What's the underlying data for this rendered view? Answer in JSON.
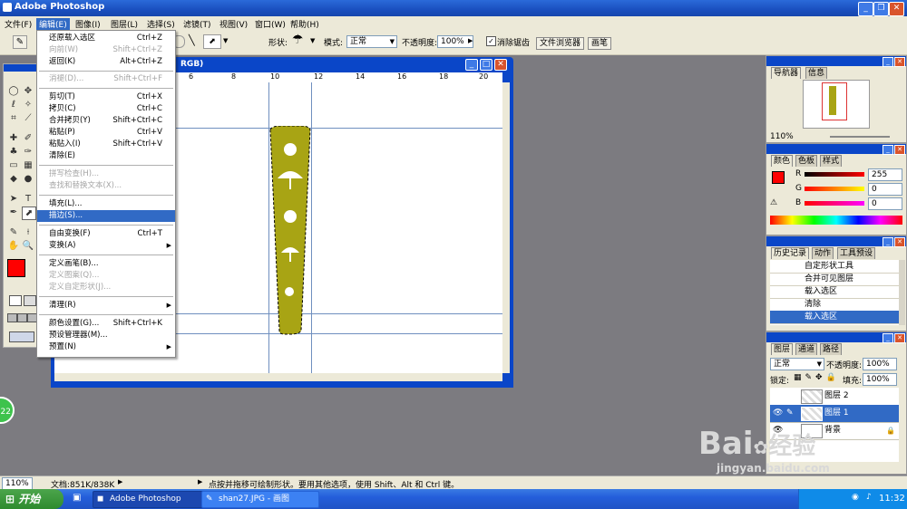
{
  "window": {
    "title": "Adobe Photoshop"
  },
  "menubar": [
    "文件(F)",
    "编辑(E)",
    "图像(I)",
    "图层(L)",
    "选择(S)",
    "滤镜(T)",
    "视图(V)",
    "窗口(W)",
    "帮助(H)"
  ],
  "options": {
    "shape_label": "形状:",
    "mode_label": "模式:",
    "mode_value": "正常",
    "opacity_label": "不透明度:",
    "opacity_value": "100%",
    "antialias_label": "消除锯齿",
    "browser_tab": "文件浏览器",
    "brush_tab": "画笔"
  },
  "document": {
    "title_partial": "RGB)",
    "ruler_labels": [
      "6",
      "8",
      "10",
      "12",
      "14",
      "16",
      "18",
      "20"
    ]
  },
  "edit_menu": {
    "items": [
      {
        "label": "还原载入选区",
        "shortcut": "Ctrl+Z",
        "disabled": false
      },
      {
        "label": "向前(W)",
        "shortcut": "Shift+Ctrl+Z",
        "disabled": true
      },
      {
        "label": "返回(K)",
        "shortcut": "Alt+Ctrl+Z",
        "disabled": false
      },
      {
        "label": "消褪(D)...",
        "shortcut": "Shift+Ctrl+F",
        "disabled": true
      },
      {
        "label": "剪切(T)",
        "shortcut": "Ctrl+X",
        "disabled": false
      },
      {
        "label": "拷贝(C)",
        "shortcut": "Ctrl+C",
        "disabled": false
      },
      {
        "label": "合并拷贝(Y)",
        "shortcut": "Shift+Ctrl+C",
        "disabled": false
      },
      {
        "label": "粘贴(P)",
        "shortcut": "Ctrl+V",
        "disabled": false
      },
      {
        "label": "粘贴入(I)",
        "shortcut": "Shift+Ctrl+V",
        "disabled": false
      },
      {
        "label": "清除(E)",
        "shortcut": "",
        "disabled": false
      },
      {
        "label": "拼写检查(H)...",
        "shortcut": "",
        "disabled": true
      },
      {
        "label": "查找和替换文本(X)...",
        "shortcut": "",
        "disabled": true
      },
      {
        "label": "填充(L)...",
        "shortcut": "",
        "disabled": false
      },
      {
        "label": "描边(S)...",
        "shortcut": "",
        "disabled": false
      },
      {
        "label": "自由变换(F)",
        "shortcut": "Ctrl+T",
        "disabled": false
      },
      {
        "label": "变换(A)",
        "shortcut": "",
        "disabled": false
      },
      {
        "label": "定义画笔(B)...",
        "shortcut": "",
        "disabled": false
      },
      {
        "label": "定义图案(Q)...",
        "shortcut": "",
        "disabled": true
      },
      {
        "label": "定义自定形状(J)...",
        "shortcut": "",
        "disabled": true
      },
      {
        "label": "清理(R)",
        "shortcut": "",
        "disabled": false
      },
      {
        "label": "颜色设置(G)...",
        "shortcut": "Shift+Ctrl+K",
        "disabled": false
      },
      {
        "label": "预设管理器(M)...",
        "shortcut": "",
        "disabled": false
      },
      {
        "label": "预置(N)",
        "shortcut": "",
        "disabled": false
      }
    ]
  },
  "navigator": {
    "tabs": [
      "导航器",
      "信息"
    ],
    "zoom": "110%"
  },
  "color": {
    "tabs": [
      "颜色",
      "色板",
      "样式"
    ],
    "r_label": "R",
    "r_value": "255",
    "g_label": "G",
    "g_value": "0",
    "b_label": "B",
    "b_value": "0",
    "swatch": "#ff0000"
  },
  "history": {
    "tabs": [
      "历史记录",
      "动作",
      "工具预设"
    ],
    "items": [
      "自定形状工具",
      "合并可见图层",
      "载入选区",
      "清除",
      "载入选区"
    ]
  },
  "layers": {
    "tabs": [
      "图层",
      "通道",
      "路径"
    ],
    "mode": "正常",
    "opacity_label": "不透明度:",
    "opacity": "100%",
    "lock_label": "锁定:",
    "fill_label": "填充:",
    "fill": "100%",
    "items": [
      "图层 2",
      "图层 1",
      "背景"
    ]
  },
  "statusbar": {
    "zoom": "110%",
    "doc": "文档:851K/838K",
    "hint": "点按并拖移可绘制形状。要用其他选项，使用 Shift、Alt 和 Ctrl 键。"
  },
  "taskbar": {
    "start": "开始",
    "tasks": [
      "Adobe Photoshop",
      "shan27.JPG - 画图"
    ],
    "time": "11:32"
  },
  "watermark": {
    "brand": "Bai",
    "brand2": "经验",
    "url": "jingyan.baidu.com"
  },
  "badge": "22",
  "colors": {
    "accent": "#316ac5",
    "shape_fill": "#a8a414",
    "title_blue": "#0a46c8"
  }
}
